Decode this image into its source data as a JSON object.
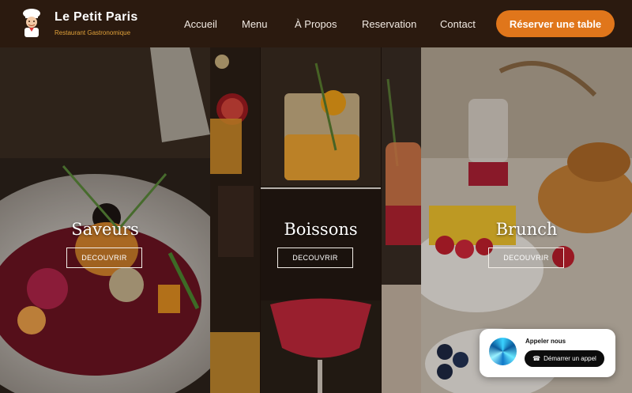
{
  "brand": {
    "name": "Le Petit Paris",
    "tagline": "Restaurant Gastronomique"
  },
  "nav": [
    {
      "label": "Accueil"
    },
    {
      "label": "Menu"
    },
    {
      "label": "À Propos"
    },
    {
      "label": "Reservation"
    },
    {
      "label": "Contact"
    }
  ],
  "cta": {
    "label": "Réserver une table"
  },
  "panels": [
    {
      "title": "Saveurs",
      "button": "DECOUVRIR"
    },
    {
      "title": "Boissons",
      "button": "DECOUVRIR"
    },
    {
      "title": "Brunch",
      "button": "DECOUVRIR"
    }
  ],
  "call_widget": {
    "label": "Appeler nous",
    "button": "Démarrer un appel"
  },
  "colors": {
    "header_bg": "#2b1a0f",
    "accent": "#e0761b",
    "tagline": "#e0a13a"
  }
}
